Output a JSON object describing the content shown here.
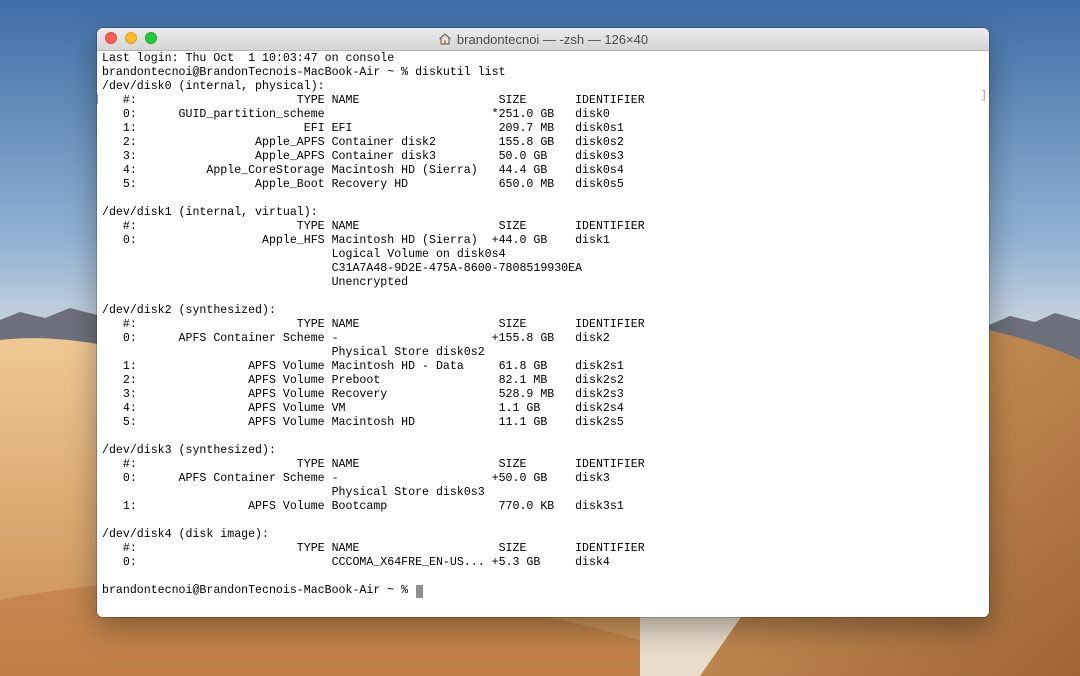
{
  "window": {
    "title": "brandontecnoi — -zsh — 126×40"
  },
  "terminal": {
    "lines": [
      "Last login: Thu Oct  1 10:03:47 on console",
      "brandontecnoi@BrandonTecnois-MacBook-Air ~ % diskutil list",
      "/dev/disk0 (internal, physical):",
      "   #:                       TYPE NAME                    SIZE       IDENTIFIER",
      "   0:      GUID_partition_scheme                        *251.0 GB   disk0",
      "   1:                        EFI EFI                     209.7 MB   disk0s1",
      "   2:                 Apple_APFS Container disk2         155.8 GB   disk0s2",
      "   3:                 Apple_APFS Container disk3         50.0 GB    disk0s3",
      "   4:          Apple_CoreStorage Macintosh HD (Sierra)   44.4 GB    disk0s4",
      "   5:                 Apple_Boot Recovery HD             650.0 MB   disk0s5",
      "",
      "/dev/disk1 (internal, virtual):",
      "   #:                       TYPE NAME                    SIZE       IDENTIFIER",
      "   0:                  Apple_HFS Macintosh HD (Sierra)  +44.0 GB    disk1",
      "                                 Logical Volume on disk0s4",
      "                                 C31A7A48-9D2E-475A-8600-7808519930EA",
      "                                 Unencrypted",
      "",
      "/dev/disk2 (synthesized):",
      "   #:                       TYPE NAME                    SIZE       IDENTIFIER",
      "   0:      APFS Container Scheme -                      +155.8 GB   disk2",
      "                                 Physical Store disk0s2",
      "   1:                APFS Volume Macintosh HD - Data     61.8 GB    disk2s1",
      "   2:                APFS Volume Preboot                 82.1 MB    disk2s2",
      "   3:                APFS Volume Recovery                528.9 MB   disk2s3",
      "   4:                APFS Volume VM                      1.1 GB     disk2s4",
      "   5:                APFS Volume Macintosh HD            11.1 GB    disk2s5",
      "",
      "/dev/disk3 (synthesized):",
      "   #:                       TYPE NAME                    SIZE       IDENTIFIER",
      "   0:      APFS Container Scheme -                      +50.0 GB    disk3",
      "                                 Physical Store disk0s3",
      "   1:                APFS Volume Bootcamp                770.0 KB   disk3s1",
      "",
      "/dev/disk4 (disk image):",
      "   #:                       TYPE NAME                    SIZE       IDENTIFIER",
      "   0:                            CCCOMA_X64FRE_EN-US... +5.3 GB     disk4",
      ""
    ],
    "prompt": "brandontecnoi@BrandonTecnois-MacBook-Air ~ % ",
    "scroll_marker": "]"
  },
  "icons": {
    "title_icon": "home-icon",
    "traffic_lights": [
      "close-button",
      "minimize-button",
      "zoom-button"
    ]
  },
  "colors": {
    "close": "#fc5f57",
    "minimize": "#fdbc2e",
    "zoom": "#28c840",
    "terminal_bg": "#ffffff",
    "terminal_fg": "#000000"
  }
}
